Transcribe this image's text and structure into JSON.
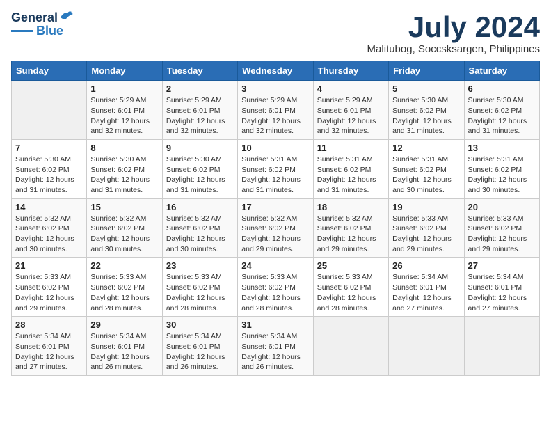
{
  "header": {
    "logo_line1": "General",
    "logo_line2": "Blue",
    "month_title": "July 2024",
    "subtitle": "Malitubog, Soccsksargen, Philippines"
  },
  "calendar": {
    "days_of_week": [
      "Sunday",
      "Monday",
      "Tuesday",
      "Wednesday",
      "Thursday",
      "Friday",
      "Saturday"
    ],
    "weeks": [
      [
        {
          "day": "",
          "info": ""
        },
        {
          "day": "1",
          "info": "Sunrise: 5:29 AM\nSunset: 6:01 PM\nDaylight: 12 hours\nand 32 minutes."
        },
        {
          "day": "2",
          "info": "Sunrise: 5:29 AM\nSunset: 6:01 PM\nDaylight: 12 hours\nand 32 minutes."
        },
        {
          "day": "3",
          "info": "Sunrise: 5:29 AM\nSunset: 6:01 PM\nDaylight: 12 hours\nand 32 minutes."
        },
        {
          "day": "4",
          "info": "Sunrise: 5:29 AM\nSunset: 6:01 PM\nDaylight: 12 hours\nand 32 minutes."
        },
        {
          "day": "5",
          "info": "Sunrise: 5:30 AM\nSunset: 6:02 PM\nDaylight: 12 hours\nand 31 minutes."
        },
        {
          "day": "6",
          "info": "Sunrise: 5:30 AM\nSunset: 6:02 PM\nDaylight: 12 hours\nand 31 minutes."
        }
      ],
      [
        {
          "day": "7",
          "info": "Sunrise: 5:30 AM\nSunset: 6:02 PM\nDaylight: 12 hours\nand 31 minutes."
        },
        {
          "day": "8",
          "info": "Sunrise: 5:30 AM\nSunset: 6:02 PM\nDaylight: 12 hours\nand 31 minutes."
        },
        {
          "day": "9",
          "info": "Sunrise: 5:30 AM\nSunset: 6:02 PM\nDaylight: 12 hours\nand 31 minutes."
        },
        {
          "day": "10",
          "info": "Sunrise: 5:31 AM\nSunset: 6:02 PM\nDaylight: 12 hours\nand 31 minutes."
        },
        {
          "day": "11",
          "info": "Sunrise: 5:31 AM\nSunset: 6:02 PM\nDaylight: 12 hours\nand 31 minutes."
        },
        {
          "day": "12",
          "info": "Sunrise: 5:31 AM\nSunset: 6:02 PM\nDaylight: 12 hours\nand 30 minutes."
        },
        {
          "day": "13",
          "info": "Sunrise: 5:31 AM\nSunset: 6:02 PM\nDaylight: 12 hours\nand 30 minutes."
        }
      ],
      [
        {
          "day": "14",
          "info": "Sunrise: 5:32 AM\nSunset: 6:02 PM\nDaylight: 12 hours\nand 30 minutes."
        },
        {
          "day": "15",
          "info": "Sunrise: 5:32 AM\nSunset: 6:02 PM\nDaylight: 12 hours\nand 30 minutes."
        },
        {
          "day": "16",
          "info": "Sunrise: 5:32 AM\nSunset: 6:02 PM\nDaylight: 12 hours\nand 30 minutes."
        },
        {
          "day": "17",
          "info": "Sunrise: 5:32 AM\nSunset: 6:02 PM\nDaylight: 12 hours\nand 29 minutes."
        },
        {
          "day": "18",
          "info": "Sunrise: 5:32 AM\nSunset: 6:02 PM\nDaylight: 12 hours\nand 29 minutes."
        },
        {
          "day": "19",
          "info": "Sunrise: 5:33 AM\nSunset: 6:02 PM\nDaylight: 12 hours\nand 29 minutes."
        },
        {
          "day": "20",
          "info": "Sunrise: 5:33 AM\nSunset: 6:02 PM\nDaylight: 12 hours\nand 29 minutes."
        }
      ],
      [
        {
          "day": "21",
          "info": "Sunrise: 5:33 AM\nSunset: 6:02 PM\nDaylight: 12 hours\nand 29 minutes."
        },
        {
          "day": "22",
          "info": "Sunrise: 5:33 AM\nSunset: 6:02 PM\nDaylight: 12 hours\nand 28 minutes."
        },
        {
          "day": "23",
          "info": "Sunrise: 5:33 AM\nSunset: 6:02 PM\nDaylight: 12 hours\nand 28 minutes."
        },
        {
          "day": "24",
          "info": "Sunrise: 5:33 AM\nSunset: 6:02 PM\nDaylight: 12 hours\nand 28 minutes."
        },
        {
          "day": "25",
          "info": "Sunrise: 5:33 AM\nSunset: 6:02 PM\nDaylight: 12 hours\nand 28 minutes."
        },
        {
          "day": "26",
          "info": "Sunrise: 5:34 AM\nSunset: 6:01 PM\nDaylight: 12 hours\nand 27 minutes."
        },
        {
          "day": "27",
          "info": "Sunrise: 5:34 AM\nSunset: 6:01 PM\nDaylight: 12 hours\nand 27 minutes."
        }
      ],
      [
        {
          "day": "28",
          "info": "Sunrise: 5:34 AM\nSunset: 6:01 PM\nDaylight: 12 hours\nand 27 minutes."
        },
        {
          "day": "29",
          "info": "Sunrise: 5:34 AM\nSunset: 6:01 PM\nDaylight: 12 hours\nand 26 minutes."
        },
        {
          "day": "30",
          "info": "Sunrise: 5:34 AM\nSunset: 6:01 PM\nDaylight: 12 hours\nand 26 minutes."
        },
        {
          "day": "31",
          "info": "Sunrise: 5:34 AM\nSunset: 6:01 PM\nDaylight: 12 hours\nand 26 minutes."
        },
        {
          "day": "",
          "info": ""
        },
        {
          "day": "",
          "info": ""
        },
        {
          "day": "",
          "info": ""
        }
      ]
    ]
  }
}
